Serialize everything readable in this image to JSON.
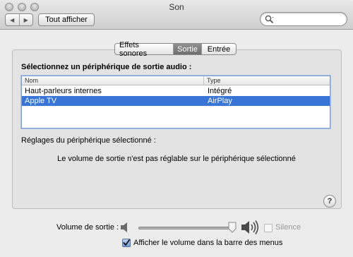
{
  "window": {
    "title": "Son"
  },
  "toolbar": {
    "back_glyph": "◀",
    "forward_glyph": "▶",
    "show_all_label": "Tout afficher",
    "search_placeholder": ""
  },
  "tabs": [
    {
      "label": "Effets sonores",
      "selected": false
    },
    {
      "label": "Sortie",
      "selected": true
    },
    {
      "label": "Entrée",
      "selected": false
    }
  ],
  "output": {
    "heading": "Sélectionnez un périphérique de sortie audio :",
    "columns": [
      "Nom",
      "Type"
    ],
    "devices": [
      {
        "name": "Haut-parleurs internes",
        "type": "Intégré",
        "selected": false
      },
      {
        "name": "Apple TV",
        "type": "AirPlay",
        "selected": true
      }
    ],
    "settings_label": "Réglages du périphérique sélectionné :",
    "settings_message": "Le volume de sortie n'est pas réglable sur le périphérique sélectionné"
  },
  "help_glyph": "?",
  "volume": {
    "label": "Volume de sortie :",
    "level": 1.0,
    "enabled": false,
    "mute_label": "Silence",
    "mute_checked": false,
    "show_in_menubar_label": "Afficher le volume dans la barre des menus",
    "show_in_menubar_checked": true
  },
  "colors": {
    "selection": "#3875d7",
    "checkbox_fill": "#6d9ee0"
  }
}
